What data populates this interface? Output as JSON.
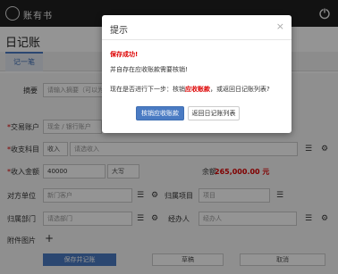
{
  "app": {
    "logo_text": "账有书"
  },
  "page": {
    "title": "日记账"
  },
  "tabs": [
    {
      "label": "记一笔"
    }
  ],
  "form": {
    "summary": {
      "label": "摘要",
      "placeholder": "请输入摘要（可以为空）"
    },
    "account": {
      "label": "交易账户",
      "placeholder": "现金 / 银行账户"
    },
    "category": {
      "label": "收支科目",
      "type": "收入",
      "placeholder": "请选收入"
    },
    "amount": {
      "label": "收入金额",
      "value": "40000",
      "converter": "大写",
      "balance_label": "余额",
      "balance_value": "265,000.00 元"
    },
    "counterparty": {
      "label": "对方单位",
      "placeholder": "新门客户"
    },
    "project": {
      "label": "归属项目",
      "placeholder": "项目"
    },
    "department": {
      "label": "归属部门",
      "placeholder": "请选部门"
    },
    "handler": {
      "label": "经办人",
      "placeholder": "经办人"
    },
    "attachment": {
      "label": "附件图片"
    }
  },
  "buttons": {
    "save": "保存并记账",
    "draft": "草稿",
    "cancel": "取消"
  },
  "modal": {
    "title": "提示",
    "close": "×",
    "success": "保存成功!",
    "line1": "并自存在应收账款需要核销!",
    "line2_prefix": "现在是否进行下一步：核销",
    "line2_highlight": "应收账款",
    "line2_suffix": "，或返回日记账列表?",
    "btn_primary": "核销应收账款",
    "btn_secondary": "返回日记账列表"
  }
}
